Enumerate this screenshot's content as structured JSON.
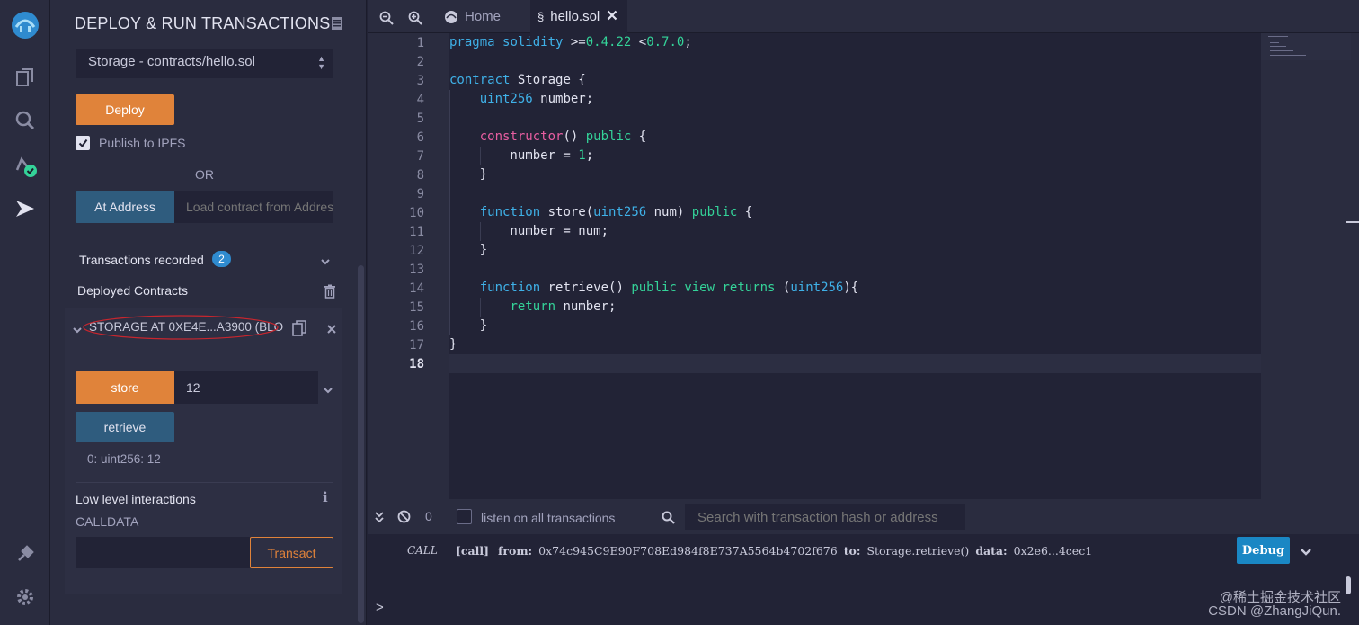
{
  "panel": {
    "title": "DEPLOY & RUN TRANSACTIONS",
    "contract_select": "Storage - contracts/hello.sol",
    "deploy_label": "Deploy",
    "publish_label": "Publish to IPFS",
    "or_label": "OR",
    "at_address_label": "At Address",
    "at_address_placeholder": "Load contract from Address",
    "transactions_recorded_label": "Transactions recorded",
    "transactions_count": "2",
    "deployed_contracts_label": "Deployed Contracts",
    "instance_title": "STORAGE AT 0XE4E...A3900 (BLO",
    "store_label": "store",
    "store_value": "12",
    "retrieve_label": "retrieve",
    "retrieve_result": "0: uint256: 12",
    "low_level_label": "Low level interactions",
    "calldata_label": "CALLDATA",
    "transact_label": "Transact"
  },
  "editor": {
    "tabs": [
      {
        "label": "Home"
      },
      {
        "label": "hello.sol"
      }
    ],
    "current_line": 18
  },
  "terminal": {
    "count": "0",
    "listen_label": "listen on all transactions",
    "search_placeholder": "Search with transaction hash or address",
    "log": {
      "kind": "CALL",
      "call": "[call]",
      "from_label": "from:",
      "from_value": "0x74c945C9E90F708Ed984f8E737A5564b4702f676",
      "to_label": "to:",
      "to_value": "Storage.retrieve()",
      "data_label": "data:",
      "data_value": "0x2e6...4cec1"
    },
    "debug_label": "Debug",
    "prompt": ">"
  },
  "watermark": {
    "line1": "@稀土掘金技术社区",
    "line2": "CSDN @ZhangJiQun."
  },
  "colors": {
    "accent_orange": "#e0833a",
    "accent_blue": "#2f5c7e",
    "badge_blue": "#2f8bcf",
    "keyword": "#3fb1e8",
    "pink": "#e85ea1",
    "green": "#34d399"
  }
}
